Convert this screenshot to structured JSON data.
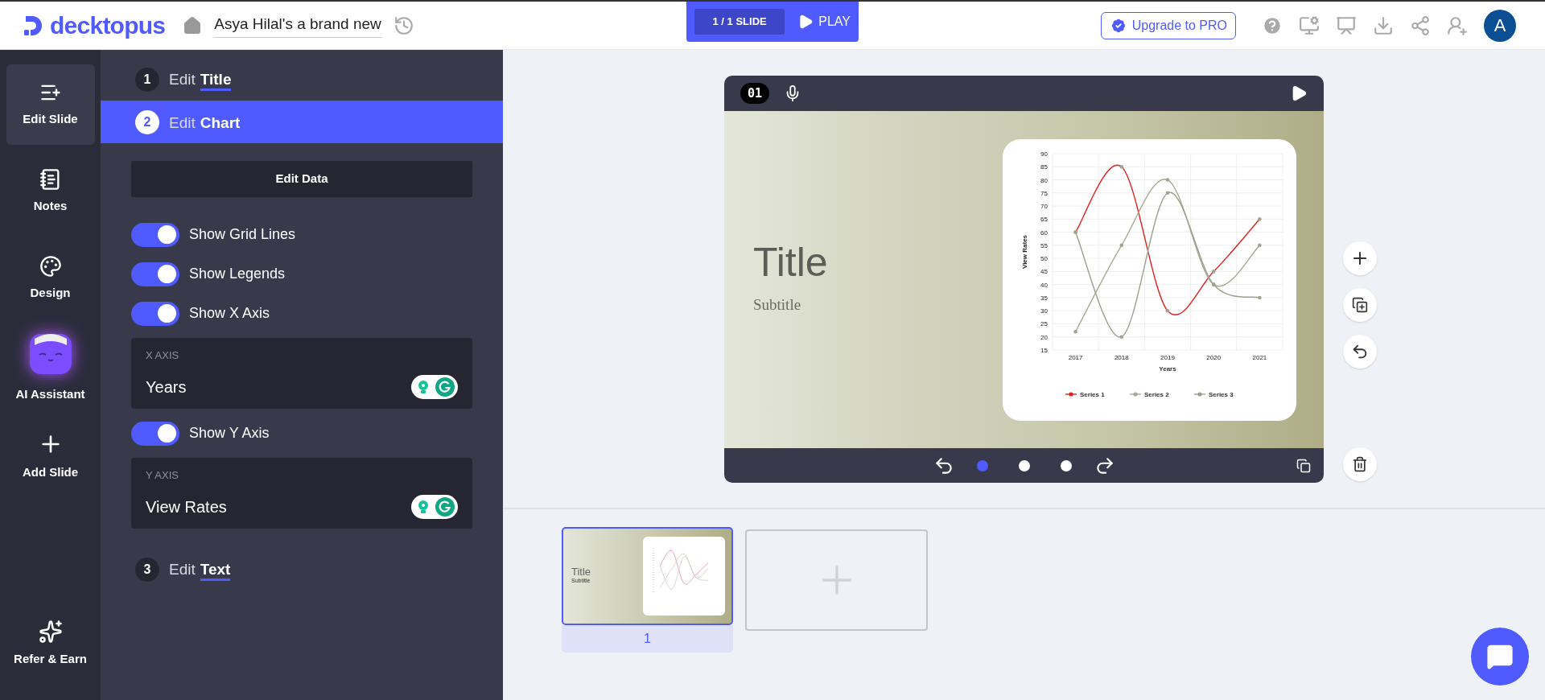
{
  "app": {
    "logo": "decktopus"
  },
  "document": {
    "title": "Asya Hilal's a brand new"
  },
  "player": {
    "counter": "1 / 1 SLIDE",
    "play": "PLAY"
  },
  "upgrade": "Upgrade to PRO",
  "avatar": "A",
  "sidebar": {
    "items": [
      {
        "label": "Edit Slide",
        "selected": true
      },
      {
        "label": "Notes",
        "selected": false
      },
      {
        "label": "Design",
        "selected": false
      },
      {
        "label": "AI Assistant",
        "selected": false
      },
      {
        "label": "Add Slide",
        "selected": false
      },
      {
        "label": "Refer & Earn",
        "selected": false
      }
    ]
  },
  "steps": [
    {
      "number": "1",
      "verb": "Edit",
      "noun": "Title",
      "selected": false
    },
    {
      "number": "2",
      "verb": "Edit",
      "noun": "Chart",
      "selected": true
    },
    {
      "number": "3",
      "verb": "Edit",
      "noun": "Text",
      "selected": false
    }
  ],
  "edit_data": "Edit Data",
  "controls": [
    {
      "kind": "toggle",
      "label": "Show Grid Lines",
      "on": true
    },
    {
      "kind": "toggle",
      "label": "Show Legends",
      "on": true
    },
    {
      "kind": "toggle",
      "label": "Show X Axis",
      "on": true
    },
    {
      "kind": "field",
      "label": "X AXIS",
      "value": "Years"
    },
    {
      "kind": "toggle",
      "label": "Show Y Axis",
      "on": true
    },
    {
      "kind": "field",
      "label": "Y AXIS",
      "value": "View Rates"
    }
  ],
  "slide": {
    "number": "01",
    "title": "Title",
    "subtitle": "Subtitle",
    "chart_data": {
      "type": "line",
      "grid": true,
      "legend": true,
      "xlabel": "Years",
      "ylabel": "View Rates",
      "categories": [
        "2017",
        "2018",
        "2019",
        "2020",
        "2021"
      ],
      "ylim": [
        15,
        90
      ],
      "yticks": [
        15,
        20,
        25,
        30,
        35,
        40,
        45,
        50,
        55,
        60,
        65,
        70,
        75,
        80,
        85,
        90
      ],
      "series": [
        {
          "name": "Series 1",
          "color": "#e0201c",
          "values": [
            60,
            85,
            30,
            45,
            65
          ]
        },
        {
          "name": "Series 2",
          "color": "#a9a893",
          "values": [
            22,
            55,
            80,
            40,
            55
          ]
        },
        {
          "name": "Series 3",
          "color": "#9f9e8e",
          "values": [
            60,
            20,
            75,
            40,
            35
          ]
        }
      ]
    }
  },
  "slide_dots": [
    {
      "selected": true
    },
    {
      "selected": false
    },
    {
      "selected": false
    }
  ],
  "thumbnails": [
    {
      "title": "Title",
      "subtitle": "Subtitle",
      "label": "1",
      "selected": true
    }
  ]
}
